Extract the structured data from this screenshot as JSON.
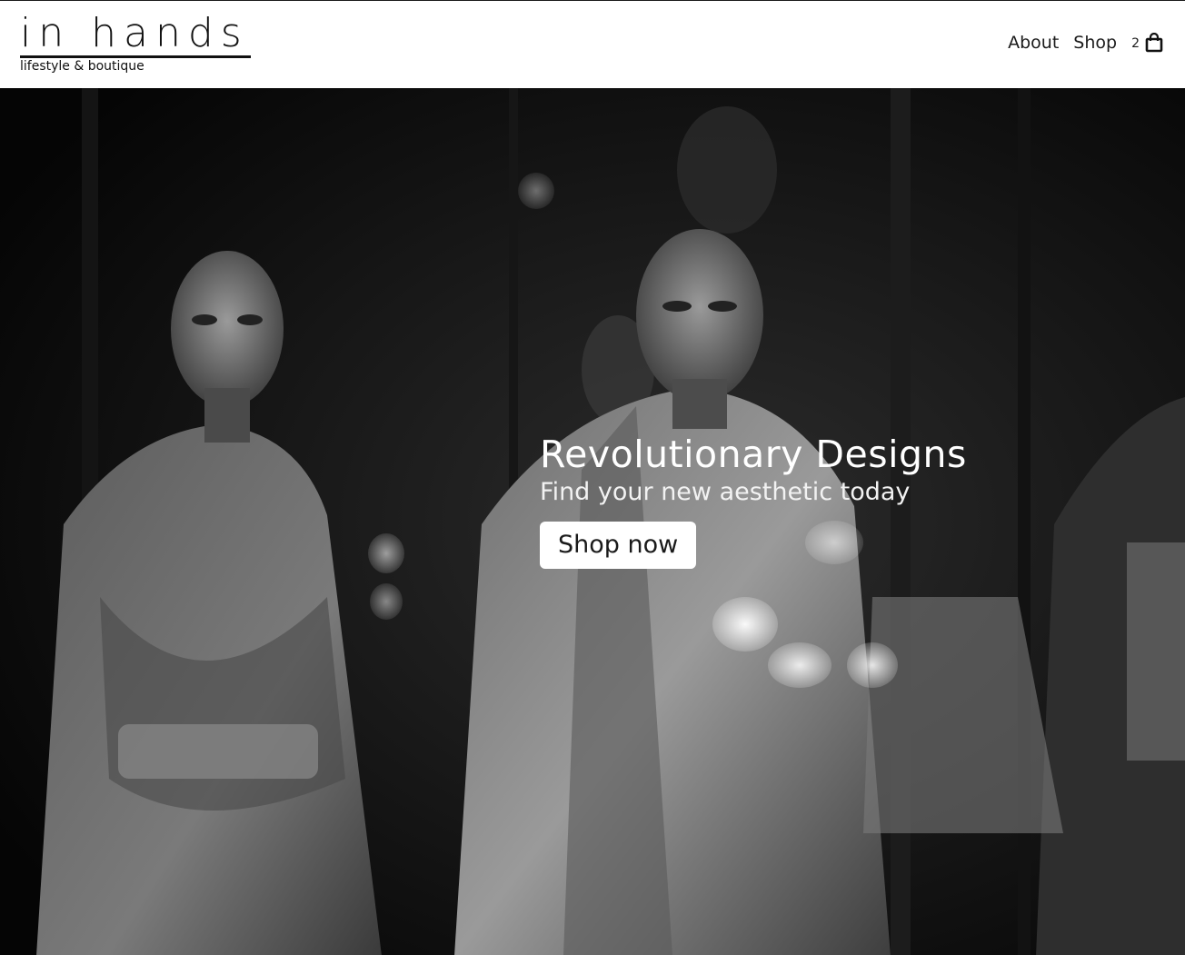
{
  "header": {
    "logo_title": "in hands",
    "logo_subtitle": "lifestyle & boutique",
    "nav": {
      "about_label": "About",
      "shop_label": "Shop",
      "cart_count": "2",
      "cart_icon": "shopping-bag-icon"
    }
  },
  "hero": {
    "title": "Revolutionary Designs",
    "subtitle": "Find your new aesthetic today",
    "button_label": "Shop now",
    "background_image": "black-and-white-mannequins-photo"
  },
  "colors": {
    "header_bg": "#ffffff",
    "text_dark": "#111111",
    "hero_bg": "#080808",
    "button_bg": "#ffffff"
  }
}
